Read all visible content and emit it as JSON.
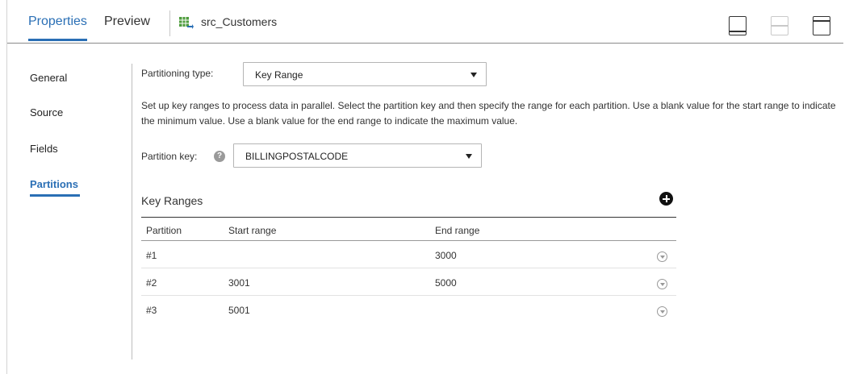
{
  "header": {
    "tabs": [
      {
        "label": "Properties",
        "active": true
      },
      {
        "label": "Preview",
        "active": false
      }
    ],
    "source_name": "src_Customers"
  },
  "sidebar": {
    "items": [
      {
        "label": "General",
        "active": false
      },
      {
        "label": "Source",
        "active": false
      },
      {
        "label": "Fields",
        "active": false
      },
      {
        "label": "Partitions",
        "active": true
      }
    ]
  },
  "main": {
    "partitioning_type_label": "Partitioning type:",
    "partitioning_type_value": "Key Range",
    "description": "Set up key ranges to process data in parallel. Select the partition key and then specify the range for each partition. Use a blank value for the start range to indicate the minimum value. Use a blank value for the end range to indicate the maximum value.",
    "partition_key_label": "Partition key:",
    "partition_key_value": "BILLINGPOSTALCODE",
    "key_ranges_title": "Key Ranges",
    "table": {
      "columns": [
        "Partition",
        "Start range",
        "End range"
      ],
      "rows": [
        {
          "partition": "#1",
          "start": "",
          "end": "3000"
        },
        {
          "partition": "#2",
          "start": "3001",
          "end": "5000"
        },
        {
          "partition": "#3",
          "start": "5001",
          "end": ""
        }
      ]
    }
  },
  "colors": {
    "accent": "#2a6fb5",
    "text": "#333333",
    "border": "#b5b5b5"
  }
}
